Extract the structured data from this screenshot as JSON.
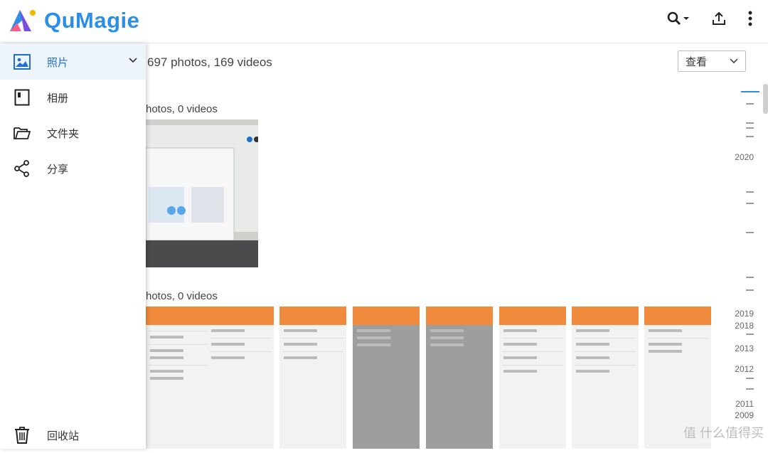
{
  "app": {
    "name": "QuMagie"
  },
  "sidebar": {
    "items": [
      {
        "label": "照片"
      },
      {
        "label": "相册"
      },
      {
        "label": "文件夹"
      },
      {
        "label": "分享"
      },
      {
        "label": "回收站"
      }
    ]
  },
  "main": {
    "summary": "697 photos, 169 videos",
    "view_label": "查看",
    "groups": [
      {
        "title": "hotos, 0 videos"
      },
      {
        "title": "hotos, 0 videos"
      }
    ]
  },
  "timeline": {
    "years": [
      "2020",
      "2019",
      "2018",
      "2013",
      "2012",
      "2011",
      "2009"
    ]
  },
  "watermark": "值 什么值得买",
  "colors": {
    "accent": "#2b8fe8",
    "app_orange": "#f08a3c"
  }
}
